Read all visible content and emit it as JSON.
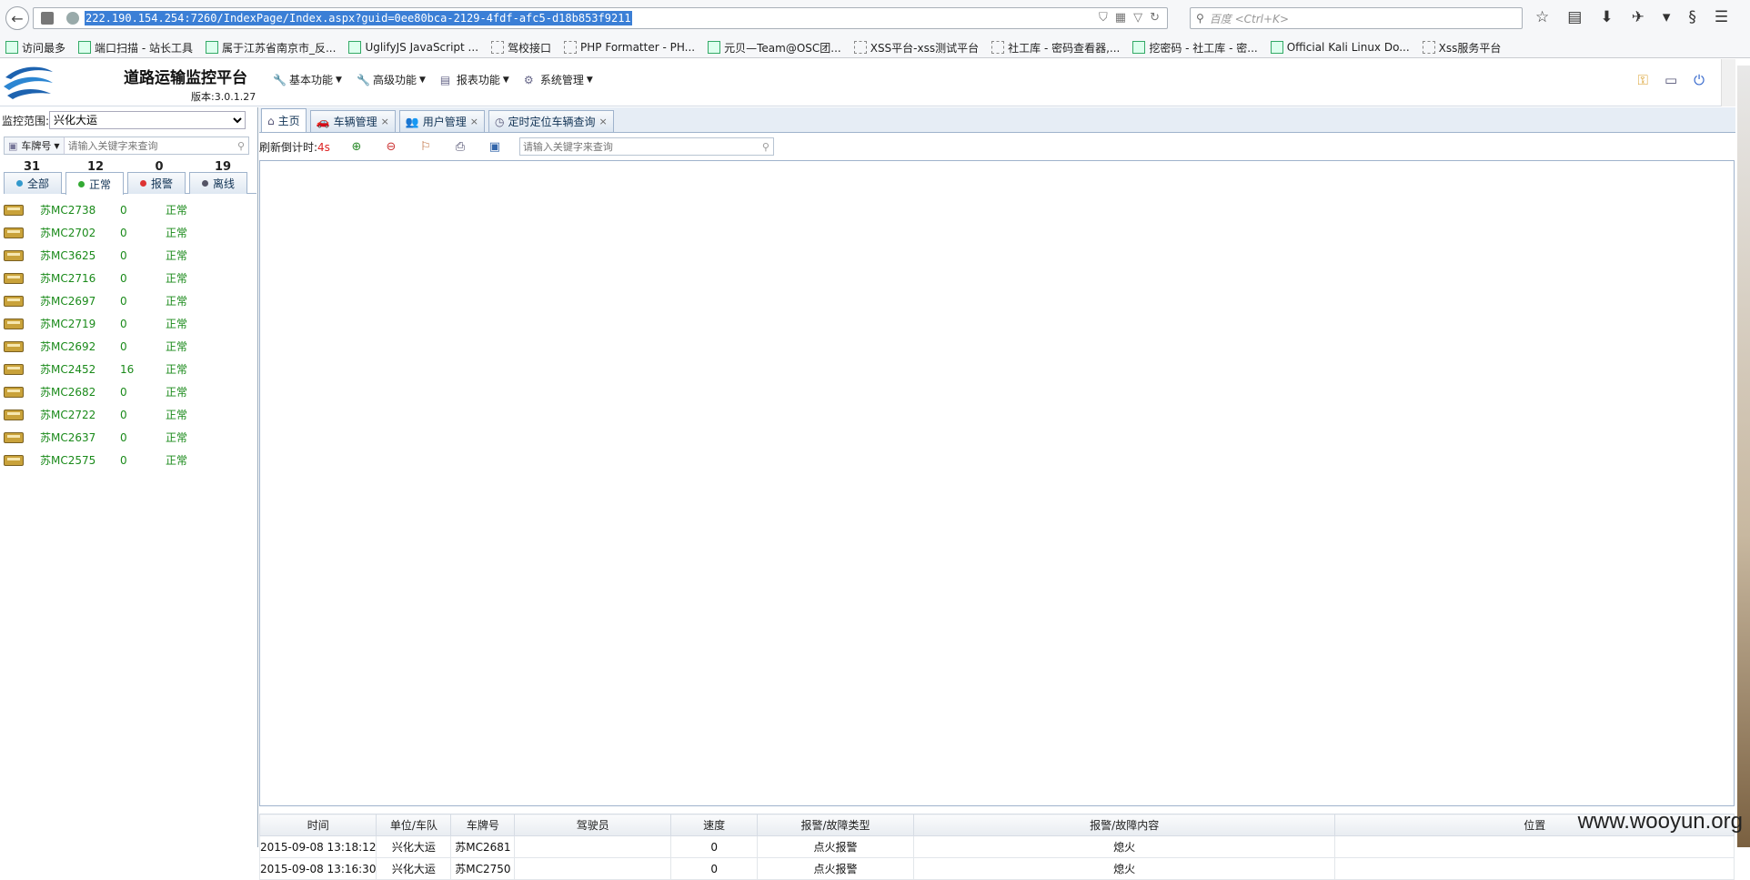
{
  "browser": {
    "url": "222.190.154.254:7260/IndexPage/Index.aspx?guid=0ee80bca-2129-4fdf-afc5-d18b853f9211",
    "search_placeholder": "百度 <Ctrl+K>",
    "bookmarks": [
      "访问最多",
      "端口扫描 - 站长工具",
      "属于江苏省南京市_反...",
      "UglifyJS JavaScript ...",
      "驾校接口",
      "PHP Formatter - PH...",
      "元贝—Team@OSC团...",
      "XSS平台-xss测试平台",
      "社工库 - 密码查看器,...",
      "挖密码 - 社工库 - 密...",
      "Official Kali Linux Do...",
      "Xss服务平台"
    ]
  },
  "app": {
    "title": "道路运输监控平台",
    "version": "版本:3.0.1.27",
    "menu": [
      "基本功能",
      "高级功能",
      "报表功能",
      "系统管理"
    ]
  },
  "left": {
    "scope_label": "监控范围:",
    "scope_value": "兴化大运",
    "filter_type": "车牌号",
    "filter_placeholder": "请输入关键字来查询",
    "counts": [
      "31",
      "12",
      "0",
      "19"
    ],
    "status_tabs": [
      "全部",
      "正常",
      "报警",
      "离线"
    ],
    "vehicles": [
      {
        "plate": "苏MC2738",
        "speed": "0",
        "status": "正常"
      },
      {
        "plate": "苏MC2702",
        "speed": "0",
        "status": "正常"
      },
      {
        "plate": "苏MC3625",
        "speed": "0",
        "status": "正常"
      },
      {
        "plate": "苏MC2716",
        "speed": "0",
        "status": "正常"
      },
      {
        "plate": "苏MC2697",
        "speed": "0",
        "status": "正常"
      },
      {
        "plate": "苏MC2719",
        "speed": "0",
        "status": "正常"
      },
      {
        "plate": "苏MC2692",
        "speed": "0",
        "status": "正常"
      },
      {
        "plate": "苏MC2452",
        "speed": "16",
        "status": "正常"
      },
      {
        "plate": "苏MC2682",
        "speed": "0",
        "status": "正常"
      },
      {
        "plate": "苏MC2722",
        "speed": "0",
        "status": "正常"
      },
      {
        "plate": "苏MC2637",
        "speed": "0",
        "status": "正常"
      },
      {
        "plate": "苏MC2575",
        "speed": "0",
        "status": "正常"
      }
    ]
  },
  "main": {
    "tabs": [
      "主页",
      "车辆管理",
      "用户管理",
      "定时定位车辆查询"
    ],
    "countdown_label": "刷新倒计时:",
    "countdown_value": "4s",
    "search_placeholder": "请输入关键字来查询",
    "alarm_table": {
      "headers": [
        "时间",
        "单位/车队",
        "车牌号",
        "驾驶员",
        "速度",
        "报警/故障类型",
        "报警/故障内容",
        "位置"
      ],
      "rows": [
        [
          "2015-09-08 13:18:12",
          "兴化大运",
          "苏MC2681",
          "",
          "0",
          "点火报警",
          "熄火",
          ""
        ],
        [
          "2015-09-08 13:16:30",
          "兴化大运",
          "苏MC2750",
          "",
          "0",
          "点火报警",
          "熄火",
          ""
        ]
      ]
    }
  },
  "watermark": "www.wooyun.org",
  "colors": {
    "normal": "#1a8a1a",
    "alarm_dot": "#d33",
    "normal_dot": "#3a3",
    "offline_dot": "#556",
    "all_dot": "#39c"
  }
}
